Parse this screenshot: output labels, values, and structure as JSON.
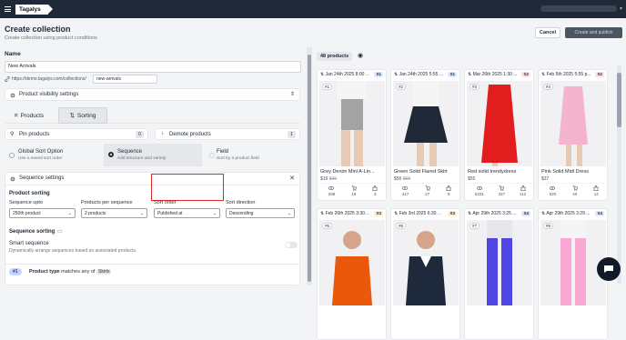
{
  "topbar": {
    "brand": "Tagalys"
  },
  "page": {
    "title": "Create collection",
    "subtitle": "Create collection using product conditions",
    "cancel": "Cancel",
    "create": "Create and publish"
  },
  "name": {
    "label": "Name",
    "value": "New Arrivals",
    "url_prefix": "https://demo.tagalys.com/collections/",
    "slug": "new-arrivals"
  },
  "visibility": {
    "label": "Product visibility settings"
  },
  "tabs": [
    {
      "label": "Products"
    },
    {
      "label": "Sorting"
    }
  ],
  "pin": {
    "label": "Pin products",
    "count": "0"
  },
  "demote": {
    "label": "Demote products",
    "count": "1"
  },
  "sort_options": [
    {
      "title": "Global Sort Option",
      "sub": "Use a saved sort order"
    },
    {
      "title": "Sequence",
      "sub": "Add structure and variety"
    },
    {
      "title": "Field",
      "sub": "Sort by a product field"
    }
  ],
  "sequence": {
    "settings_label": "Sequence settings",
    "product_sorting": "Product sorting",
    "fields": [
      {
        "label": "Sequence upto",
        "value": "250th product"
      },
      {
        "label": "Products per sequence",
        "value": "2 products"
      },
      {
        "label": "Sort order",
        "value": "Published at"
      },
      {
        "label": "Sort direction",
        "value": "Descending"
      }
    ],
    "sorting_label": "Sequence sorting",
    "smart_label": "Smart sequence",
    "smart_desc": "Dynamically arrange sequences based on associated products."
  },
  "condition": {
    "index": "#1",
    "field": "Product type",
    "op": "matches any of",
    "value": "Skirts"
  },
  "products": {
    "count_label": "48 products",
    "items": [
      {
        "date": "Jan 24th 2025 8:00 ...",
        "tag": "S1",
        "idx": "#1",
        "name": "Grey Denim Mini A-Lin...",
        "price": "$19",
        "old": "$29",
        "views": "298",
        "carts": "16",
        "buys": "3"
      },
      {
        "date": "Jan 24th 2025 5:55 ...",
        "tag": "S1",
        "idx": "#2",
        "name": "Green Solid Flared Skirt",
        "price": "$56",
        "old": "$58",
        "views": "417",
        "carts": "27",
        "buys": "9"
      },
      {
        "date": "Mar 26th 2025 1:30 ...",
        "tag": "S2",
        "idx": "#3",
        "name": "Red solid trendydress",
        "price": "$55",
        "old": "",
        "views": "5331",
        "carts": "327",
        "buys": "112"
      },
      {
        "date": "Feb 5th 2025 5:55 p...",
        "tag": "S2",
        "idx": "#4",
        "name": "Pink Solid Midi Dress",
        "price": "$37",
        "old": "",
        "views": "520",
        "carts": "40",
        "buys": "14"
      },
      {
        "date": "Feb 26th 2025 3:30...",
        "tag": "S3",
        "idx": "#5",
        "name": "",
        "price": "",
        "old": "",
        "views": "",
        "carts": "",
        "buys": ""
      },
      {
        "date": "Feb 3rd 2025 6:30 ...",
        "tag": "S3",
        "idx": "#6",
        "name": "",
        "price": "",
        "old": "",
        "views": "",
        "carts": "",
        "buys": ""
      },
      {
        "date": "Apr 29th 2025 3:25 ...",
        "tag": "S4",
        "idx": "#7",
        "name": "",
        "price": "",
        "old": "",
        "views": "",
        "carts": "",
        "buys": ""
      },
      {
        "date": "Apr 29th 2025 3:29 ...",
        "tag": "S4",
        "idx": "#8",
        "name": "",
        "price": "",
        "old": "",
        "views": "",
        "carts": "",
        "buys": ""
      }
    ]
  },
  "colors": {
    "accent": "#5b6cff",
    "s1": "#dbeafe",
    "s2": "#fee2e2",
    "s3": "#ffedd5",
    "s4": "#e0e7ff",
    "highlight": "#dc2626"
  }
}
